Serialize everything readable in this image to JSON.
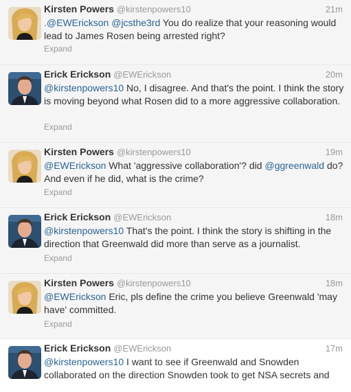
{
  "tweets": [
    {
      "name": "Kirsten Powers",
      "handle": "@kirstenpowers10",
      "time": "21m",
      "avatar": "kirsten-avatar",
      "parts": [
        {
          "t": ".@EWErickson",
          "m": true
        },
        {
          "t": " ",
          "m": false
        },
        {
          "t": "@jcsthe3rd",
          "m": true
        },
        {
          "t": " You do realize that your reasoning would lead to James Rosen being arrested right?",
          "m": false
        }
      ],
      "expand": "Expand"
    },
    {
      "name": "Erick Erickson",
      "handle": "@EWErickson",
      "time": "20m",
      "avatar": "erick-avatar",
      "parts": [
        {
          "t": "@kirstenpowers10",
          "m": true
        },
        {
          "t": " No, I disagree. And that's the point. I think the story is moving beyond what Rosen did to a more aggressive collaboration.",
          "m": false
        }
      ],
      "expand": "Expand"
    },
    {
      "name": "Kirsten Powers",
      "handle": "@kirstenpowers10",
      "time": "19m",
      "avatar": "kirsten-avatar",
      "parts": [
        {
          "t": "@EWErickson",
          "m": true
        },
        {
          "t": " What 'aggressive collaboration'? did ",
          "m": false
        },
        {
          "t": "@ggreenwald",
          "m": true
        },
        {
          "t": " do?  And even if he did, what is the crime?",
          "m": false
        }
      ],
      "expand": "Expand"
    },
    {
      "name": "Erick Erickson",
      "handle": "@EWErickson",
      "time": "18m",
      "avatar": "erick-avatar",
      "parts": [
        {
          "t": "@kirstenpowers10",
          "m": true
        },
        {
          "t": " That's the point.  I think the story is shifting in the direction that Greenwald did more than serve as a journalist.",
          "m": false
        }
      ],
      "expand": "Expand"
    },
    {
      "name": "Kirsten Powers",
      "handle": "@kirstenpowers10",
      "time": "18m",
      "avatar": "kirsten-avatar",
      "parts": [
        {
          "t": "@EWErickson",
          "m": true
        },
        {
          "t": " Eric, pls define the crime you believe Greenwald 'may have' committed.",
          "m": false
        }
      ],
      "expand": "Expand"
    },
    {
      "name": "Erick Erickson",
      "handle": "@EWErickson",
      "time": "17m",
      "avatar": "erick-avatar",
      "parts": [
        {
          "t": "@kirstenpowers10",
          "m": true
        },
        {
          "t": " I want to see if Greenwald and Snowden collaborated on the direction Snowden took to get NSA secrets and",
          "m": false
        }
      ],
      "expand": ""
    }
  ]
}
